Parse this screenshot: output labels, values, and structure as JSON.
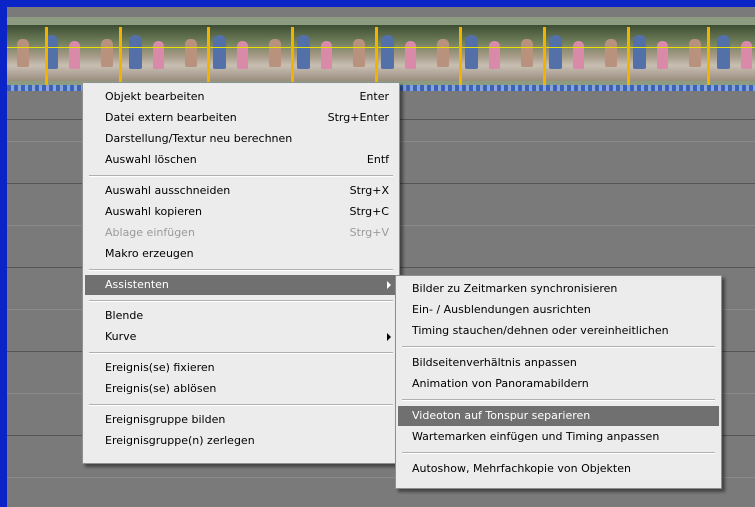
{
  "colors": {
    "frame": "#0b24c8",
    "timeline_bg": "#7a7a7a",
    "menu_bg": "#ececec",
    "highlight": "#707070",
    "marker": "#f0b400"
  },
  "context_menu": {
    "groups": [
      [
        {
          "label": "Objekt bearbeiten",
          "shortcut": "Enter",
          "enabled": true
        },
        {
          "label": "Datei extern bearbeiten",
          "shortcut": "Strg+Enter",
          "enabled": true
        },
        {
          "label": "Darstellung/Textur neu berechnen",
          "shortcut": "",
          "enabled": true
        },
        {
          "label": "Auswahl löschen",
          "shortcut": "Entf",
          "enabled": true
        }
      ],
      [
        {
          "label": "Auswahl ausschneiden",
          "shortcut": "Strg+X",
          "enabled": true
        },
        {
          "label": "Auswahl kopieren",
          "shortcut": "Strg+C",
          "enabled": true
        },
        {
          "label": "Ablage einfügen",
          "shortcut": "Strg+V",
          "enabled": false
        },
        {
          "label": "Makro erzeugen",
          "shortcut": "",
          "enabled": true
        }
      ],
      [
        {
          "label": "Assistenten",
          "shortcut": "",
          "enabled": true,
          "submenu": true,
          "highlighted": true
        }
      ],
      [
        {
          "label": "Blende",
          "shortcut": "",
          "enabled": true
        },
        {
          "label": "Kurve",
          "shortcut": "",
          "enabled": true,
          "submenu": true
        }
      ],
      [
        {
          "label": "Ereignis(se) fixieren",
          "shortcut": "",
          "enabled": true
        },
        {
          "label": "Ereignis(se) ablösen",
          "shortcut": "",
          "enabled": true
        }
      ],
      [
        {
          "label": "Ereignisgruppe bilden",
          "shortcut": "",
          "enabled": true
        },
        {
          "label": "Ereignisgruppe(n) zerlegen",
          "shortcut": "",
          "enabled": true
        }
      ]
    ]
  },
  "assistenten_submenu": {
    "groups": [
      [
        {
          "label": "Bilder zu Zeitmarken synchronisieren"
        },
        {
          "label": "Ein- / Ausblendungen ausrichten"
        },
        {
          "label": "Timing stauchen/dehnen oder vereinheitlichen"
        }
      ],
      [
        {
          "label": "Bildseitenverhältnis anpassen"
        },
        {
          "label": "Animation von Panoramabildern"
        }
      ],
      [
        {
          "label": "Videoton auf Tonspur separieren",
          "highlighted": true
        },
        {
          "label": "Wartemarken einfügen und Timing anpassen"
        }
      ],
      [
        {
          "label": "Autoshow, Mehrfachkopie von Objekten"
        }
      ]
    ]
  }
}
